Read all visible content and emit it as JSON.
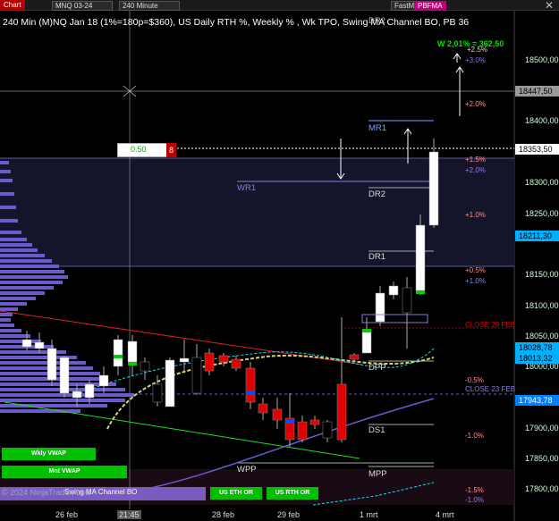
{
  "toolbar": {
    "chart_tab": "Chart",
    "instrument": "MNQ 03-24",
    "interval": "240 Minute",
    "fastma": "FastMA",
    "pbfma": "PBFMA",
    "close_glyph": "✕"
  },
  "chart_title": "240 Min (M)NQ Jan 18 (1%=180p=$360), US Daily RTH %, Weekly % , Wk TPO, Swing MA Channel BO, PB 36",
  "weekly_label": "W 2,01% = 362,50",
  "copyright": "© 2024 NinjaTrader, LLC",
  "order_box": {
    "qty": "0.50",
    "count": "8"
  },
  "levels": {
    "dr2_top": "DR2",
    "mr1": "MR1",
    "wr1": "WR1",
    "dr2": "DR2",
    "dr1": "DR1",
    "dpp": "DPP",
    "ds1": "DS1",
    "wpp": "WPP",
    "mpp": "MPP",
    "close_29": "CLOSE 29 FEB",
    "close_23": "CLOSE 23 FEB"
  },
  "percents": {
    "p25": "+2.5%",
    "p30": "+3.0%",
    "p20a": "+2.0%",
    "p15": "+1.5%",
    "p20b": "+2.0%",
    "p10a": "+1.0%",
    "p05": "+0.5%",
    "p10b": "+1.0%",
    "m05": "-0.5%",
    "m10": "-1.0%",
    "m15": "-1.5%",
    "m10b": "-1.0%"
  },
  "price_axis": {
    "ticks": [
      "18500,00",
      "18400,00",
      "18300,00",
      "18250,00",
      "18150,00",
      "18100,00",
      "18050,00",
      "18000,00",
      "17900,00",
      "17850,00",
      "17800,00"
    ],
    "badges": [
      {
        "text": "18447,50",
        "bg": "#9a9a9a",
        "color": "#000"
      },
      {
        "text": "18353,50",
        "bg": "#ffffff",
        "color": "#000"
      },
      {
        "text": "18211,30",
        "bg": "#00b0ff",
        "color": "#000"
      },
      {
        "text": "18028,78",
        "bg": "#00b0ff",
        "color": "#000"
      },
      {
        "text": "18013,32",
        "bg": "#00b0ff",
        "color": "#000"
      },
      {
        "text": "17943,78",
        "bg": "#0080ff",
        "color": "#fff"
      }
    ]
  },
  "dates": [
    "26 feb",
    "21:45",
    "28 feb",
    "29 feb",
    "1 mrt",
    "4 mrt"
  ],
  "buttons": {
    "wkly_vwap": "Wkly VWAP",
    "mnt_vwap": "Mnt VWAP",
    "swing_ma": "Swing MA Channel BO",
    "us_eth_or": "US ETH OR",
    "us_rth_or": "US RTH OR"
  },
  "colors": {
    "up": "#ffffff",
    "down": "#e00000",
    "tpo": "#6a5acd",
    "accent_cyan": "#00e5ff",
    "ma_yellow": "#d8cf7a"
  }
}
